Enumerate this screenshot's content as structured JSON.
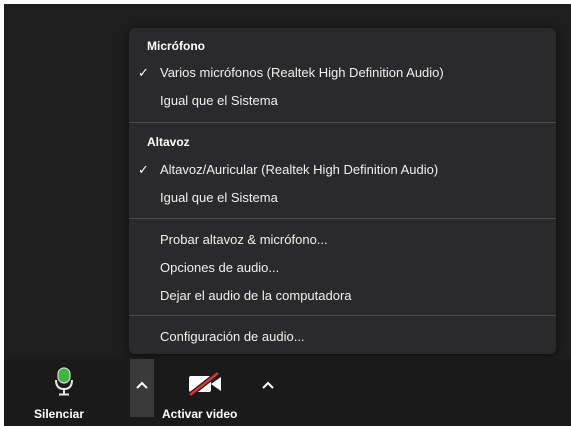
{
  "audio_menu": {
    "microphone": {
      "title": "Micrófono",
      "items": [
        {
          "label": "Varios micrófonos (Realtek High Definition Audio)",
          "checked": true
        },
        {
          "label": "Igual que el Sistema",
          "checked": false
        }
      ]
    },
    "speaker": {
      "title": "Altavoz",
      "items": [
        {
          "label": "Altavoz/Auricular (Realtek High Definition Audio)",
          "checked": true
        },
        {
          "label": "Igual que el Sistema",
          "checked": false
        }
      ]
    },
    "actions": [
      {
        "label": "Probar altavoz & micrófono..."
      },
      {
        "label": "Opciones de audio..."
      },
      {
        "label": "Dejar el audio de la computadora"
      }
    ],
    "settings": {
      "label": "Configuración de audio..."
    },
    "check_mark": "✓"
  },
  "toolbar": {
    "mute": {
      "label": "Silenciar",
      "icon": "microphone-icon",
      "icon_color": "#3fb63f"
    },
    "start_video": {
      "label": "Activar video",
      "icon": "video-off-icon",
      "slash_color": "#e0303a"
    }
  }
}
